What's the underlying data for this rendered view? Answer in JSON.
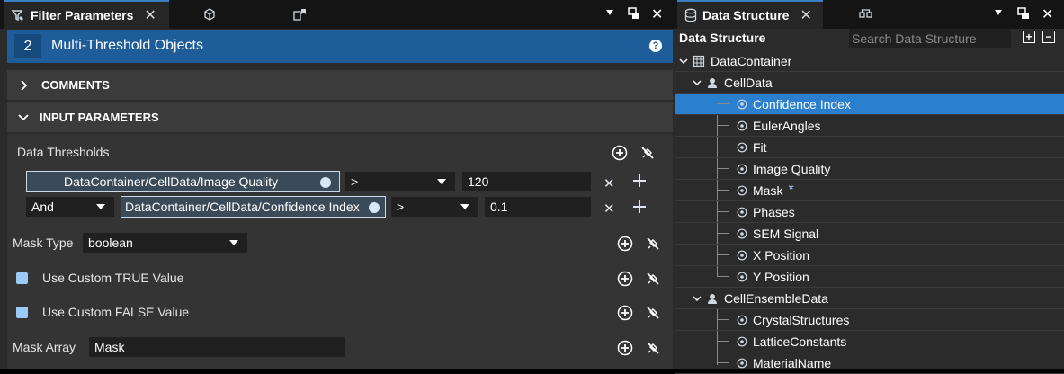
{
  "left_panel": {
    "tabs": [
      {
        "label": "Filter Parameters",
        "icon": "filter-params-icon",
        "active": true
      },
      {
        "label": "",
        "icon": "pipeline-icon"
      },
      {
        "label": "",
        "icon": "bookmark-icon"
      }
    ],
    "header": {
      "number": "2",
      "title": "Multi-Threshold Objects",
      "help": "?"
    },
    "sections": {
      "comments": "COMMENTS",
      "input_parameters": "INPUT PARAMETERS"
    },
    "data_thresholds": {
      "label": "Data Thresholds",
      "rows": [
        {
          "logic": "",
          "path": "DataContainer/CellData/Image Quality",
          "operator": ">",
          "value": "120"
        },
        {
          "logic": "And",
          "path": "DataContainer/CellData/Confidence Index",
          "operator": ">",
          "value": "0.1"
        }
      ]
    },
    "mask_type": {
      "label": "Mask Type",
      "value": "boolean"
    },
    "custom_true": {
      "label": "Use Custom TRUE Value"
    },
    "custom_false": {
      "label": "Use Custom FALSE Value"
    },
    "mask_array": {
      "label": "Mask Array",
      "value": "Mask"
    }
  },
  "right_panel": {
    "tabs": [
      {
        "label": "Data Structure",
        "icon": "database-icon",
        "active": true
      },
      {
        "label": "",
        "icon": "structure-tree-icon"
      }
    ],
    "title": "Data Structure",
    "search_placeholder": "Search Data Structure",
    "tree": {
      "container": "DataContainer",
      "cell_data": {
        "label": "CellData",
        "arrays": [
          "Confidence Index",
          "EulerAngles",
          "Fit",
          "Image Quality",
          "Mask",
          "Phases",
          "SEM Signal",
          "X Position",
          "Y Position"
        ],
        "selected": "Confidence Index",
        "created_marker": "*"
      },
      "cell_ensemble": {
        "label": "CellEnsembleData",
        "arrays": [
          "CrystalStructures",
          "LatticeConstants",
          "MaterialName"
        ]
      }
    }
  },
  "colors": {
    "accent": "#2a7fce",
    "header": "#1e5d9a",
    "checkbox": "#9ccaf6"
  }
}
